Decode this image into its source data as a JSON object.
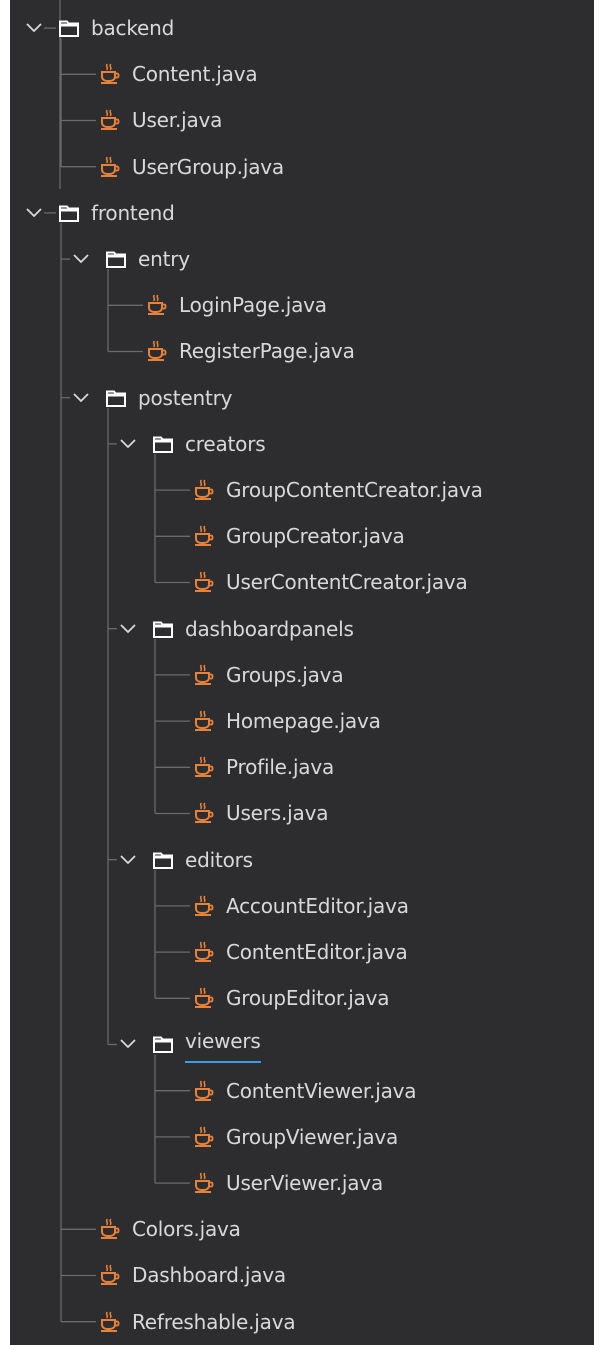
{
  "colors": {
    "background": "#2d2d30",
    "text": "#d9d9d9",
    "guide": "#6a6a6a",
    "java_icon": "#e8823a",
    "folder_icon": "#ffffff",
    "selection_underline": "#3b9ce8"
  },
  "tree": [
    {
      "depth": 1,
      "type": "folder",
      "name": "backend",
      "expanded": true,
      "icon": "folder-icon"
    },
    {
      "depth": 2,
      "type": "file",
      "name": "Content.java",
      "icon": "java-coffee-icon"
    },
    {
      "depth": 2,
      "type": "file",
      "name": "User.java",
      "icon": "java-coffee-icon"
    },
    {
      "depth": 2,
      "type": "file",
      "name": "UserGroup.java",
      "icon": "java-coffee-icon"
    },
    {
      "depth": 1,
      "type": "folder",
      "name": "frontend",
      "expanded": true,
      "icon": "folder-icon"
    },
    {
      "depth": 2,
      "type": "folder",
      "name": "entry",
      "expanded": true,
      "icon": "folder-icon"
    },
    {
      "depth": 3,
      "type": "file",
      "name": "LoginPage.java",
      "icon": "java-coffee-icon"
    },
    {
      "depth": 3,
      "type": "file",
      "name": "RegisterPage.java",
      "icon": "java-coffee-icon"
    },
    {
      "depth": 2,
      "type": "folder",
      "name": "postentry",
      "expanded": true,
      "icon": "folder-icon"
    },
    {
      "depth": 3,
      "type": "folder",
      "name": "creators",
      "expanded": true,
      "icon": "folder-icon"
    },
    {
      "depth": 4,
      "type": "file",
      "name": "GroupContentCreator.java",
      "icon": "java-coffee-icon"
    },
    {
      "depth": 4,
      "type": "file",
      "name": "GroupCreator.java",
      "icon": "java-coffee-icon"
    },
    {
      "depth": 4,
      "type": "file",
      "name": "UserContentCreator.java",
      "icon": "java-coffee-icon"
    },
    {
      "depth": 3,
      "type": "folder",
      "name": "dashboardpanels",
      "expanded": true,
      "icon": "folder-icon"
    },
    {
      "depth": 4,
      "type": "file",
      "name": "Groups.java",
      "icon": "java-coffee-icon"
    },
    {
      "depth": 4,
      "type": "file",
      "name": "Homepage.java",
      "icon": "java-coffee-icon"
    },
    {
      "depth": 4,
      "type": "file",
      "name": "Profile.java",
      "icon": "java-coffee-icon"
    },
    {
      "depth": 4,
      "type": "file",
      "name": "Users.java",
      "icon": "java-coffee-icon"
    },
    {
      "depth": 3,
      "type": "folder",
      "name": "editors",
      "expanded": true,
      "icon": "folder-icon"
    },
    {
      "depth": 4,
      "type": "file",
      "name": "AccountEditor.java",
      "icon": "java-coffee-icon"
    },
    {
      "depth": 4,
      "type": "file",
      "name": "ContentEditor.java",
      "icon": "java-coffee-icon"
    },
    {
      "depth": 4,
      "type": "file",
      "name": "GroupEditor.java",
      "icon": "java-coffee-icon"
    },
    {
      "depth": 3,
      "type": "folder",
      "name": "viewers",
      "expanded": true,
      "selected": true,
      "icon": "folder-icon"
    },
    {
      "depth": 4,
      "type": "file",
      "name": "ContentViewer.java",
      "icon": "java-coffee-icon"
    },
    {
      "depth": 4,
      "type": "file",
      "name": "GroupViewer.java",
      "icon": "java-coffee-icon"
    },
    {
      "depth": 4,
      "type": "file",
      "name": "UserViewer.java",
      "icon": "java-coffee-icon"
    },
    {
      "depth": 2,
      "type": "file",
      "name": "Colors.java",
      "icon": "java-coffee-icon"
    },
    {
      "depth": 2,
      "type": "file",
      "name": "Dashboard.java",
      "icon": "java-coffee-icon"
    },
    {
      "depth": 2,
      "type": "file",
      "name": "Refreshable.java",
      "icon": "java-coffee-icon"
    }
  ]
}
